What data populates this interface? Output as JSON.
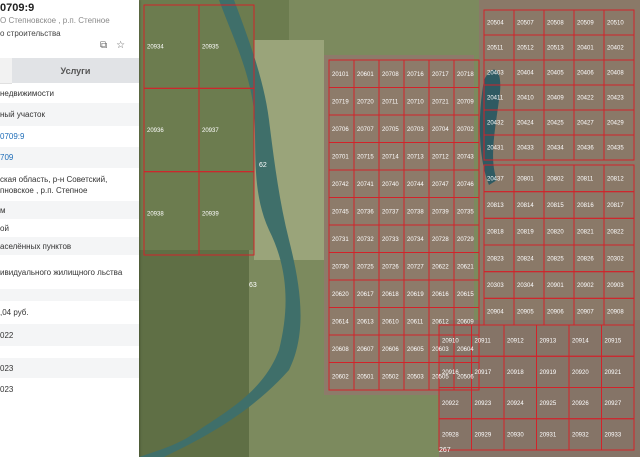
{
  "panel": {
    "title": "0709:9",
    "subtitle": "О Степновское , р.п. Степное",
    "subtitle2": "о строительства",
    "icons": [
      "copy-icon",
      "star-icon"
    ],
    "tabs": {
      "left": "",
      "services": "Услуги"
    },
    "rows": [
      "недвижимости",
      "ный участок",
      "0709:9",
      "709",
      "ская область, р-н Советский, пновское , р.п. Степное",
      "м",
      "ой",
      "аселённых пунктов",
      "ивидуального жилищного льства",
      "",
      ",04 руб.",
      "022",
      "",
      "023",
      "023"
    ]
  },
  "map": {
    "parcel_labels": [
      "20101",
      "20601",
      "20708",
      "20716",
      "20717",
      "20718",
      "20719",
      "20720",
      "20711",
      "20710",
      "20721",
      "20709",
      "20706",
      "20707",
      "20705",
      "20703",
      "20704",
      "20702",
      "20701",
      "20715",
      "20714",
      "20713",
      "20712",
      "20743",
      "20742",
      "20741",
      "20740",
      "20744",
      "20747",
      "20746",
      "20745",
      "20736",
      "20737",
      "20738",
      "20739",
      "20735",
      "20731",
      "20732",
      "20733",
      "20734",
      "20728",
      "20729",
      "20730",
      "20725",
      "20726",
      "20727",
      "20622",
      "20621",
      "20620",
      "20617",
      "20618",
      "20619",
      "20616",
      "20615",
      "20614",
      "20613",
      "20610",
      "20611",
      "20612",
      "20609",
      "20608",
      "20607",
      "20606",
      "20605",
      "20603",
      "20604",
      "20602",
      "20501",
      "20502",
      "20503",
      "20505",
      "20506",
      "20504",
      "20507",
      "20508",
      "20509",
      "20510",
      "20511",
      "20512",
      "20513",
      "20401",
      "20402",
      "20403",
      "20404",
      "20405",
      "20406",
      "20408",
      "20411",
      "20410",
      "20409",
      "20422",
      "20423",
      "20432",
      "20424",
      "20425",
      "20427",
      "20429",
      "20431",
      "20433",
      "20434",
      "20436",
      "20435",
      "20437",
      "20801",
      "20802",
      "20811",
      "20812",
      "20813",
      "20814",
      "20815",
      "20816",
      "20817",
      "20818",
      "20819",
      "20820",
      "20821",
      "20822",
      "20823",
      "20824",
      "20825",
      "20826",
      "20302",
      "20303",
      "20304",
      "20901",
      "20902",
      "20903",
      "20904",
      "20905",
      "20906",
      "20907",
      "20908",
      "20910",
      "20911",
      "20912",
      "20913",
      "20914",
      "20915",
      "20916",
      "20917",
      "20918",
      "20919",
      "20920",
      "20921",
      "20922",
      "20923",
      "20924",
      "20925",
      "20926",
      "20927",
      "20928",
      "20929",
      "20930",
      "20931",
      "20932",
      "20933",
      "20934",
      "20935",
      "20936",
      "20937",
      "20938",
      "20939",
      "20940",
      "20941"
    ],
    "road_labels": [
      "62",
      "63",
      "267"
    ],
    "colors": {
      "boundary": "#d2232a",
      "panel_link": "#1e6db8"
    }
  }
}
